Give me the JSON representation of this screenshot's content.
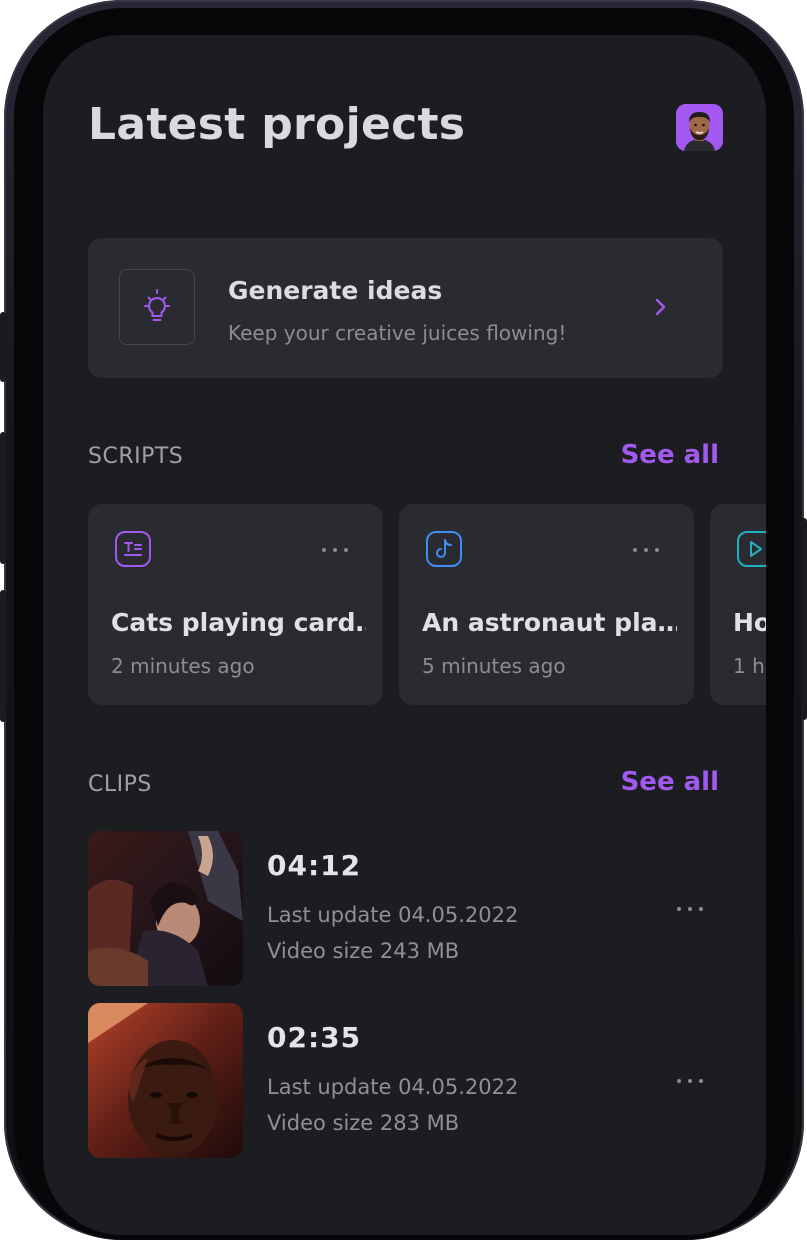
{
  "header": {
    "title": "Latest projects",
    "avatar_icon": "user-avatar"
  },
  "ideas": {
    "title": "Generate ideas",
    "subtitle": "Keep your creative juices flowing!",
    "icon": "lightbulb-icon",
    "accent": "#a259f0"
  },
  "scripts": {
    "label": "SCRIPTS",
    "see_all": "See all",
    "items": [
      {
        "title": "Cats playing card…",
        "time": "2 minutes ago",
        "icon": "text-script-icon",
        "color": "#a259f0"
      },
      {
        "title": "An astronaut pla…",
        "time": "5 minutes ago",
        "icon": "tiktok-icon",
        "color": "#3f8df5"
      },
      {
        "title": "Ho",
        "time": "1 h",
        "icon": "play-icon",
        "color": "#1fb0c2"
      }
    ]
  },
  "clips": {
    "label": "CLIPS",
    "see_all": "See all",
    "items": [
      {
        "duration": "04:12",
        "updated": "Last update 04.05.2022",
        "size": "Video size 243 MB"
      },
      {
        "duration": "02:35",
        "updated": "Last update 04.05.2022",
        "size": "Video size 283 MB"
      }
    ]
  }
}
